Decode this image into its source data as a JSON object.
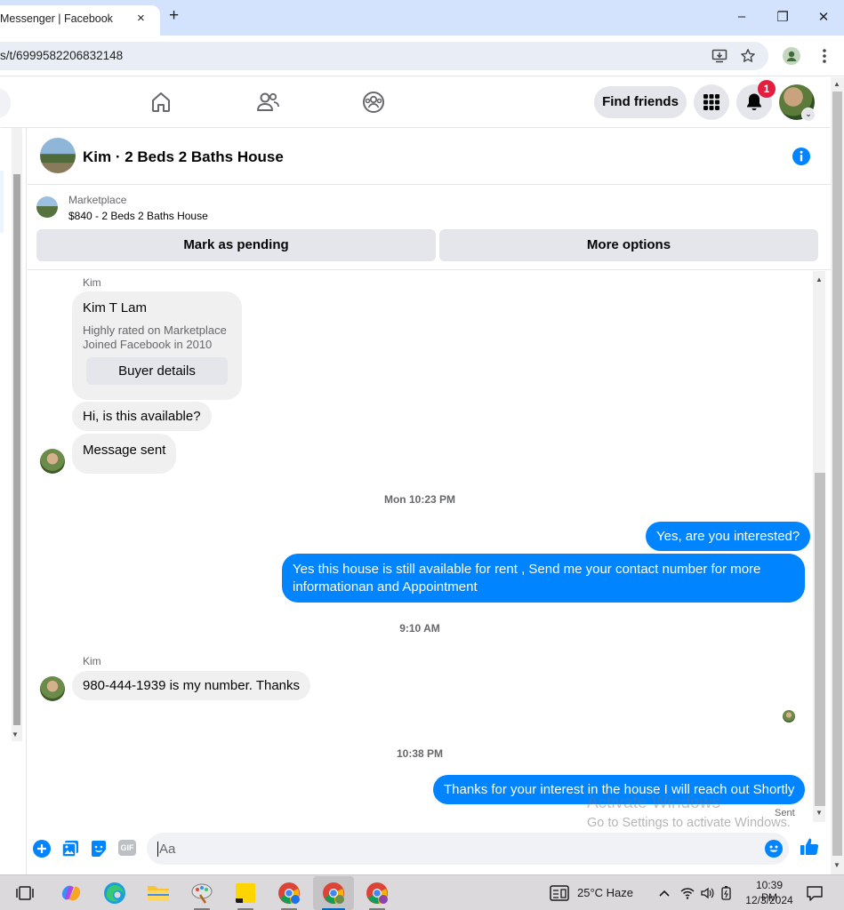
{
  "browser": {
    "tab_title": "Messenger | Facebook",
    "tab_close": "×",
    "new_tab": "+",
    "url": "s/t/6999582206832148",
    "window_controls": {
      "minimize": "–",
      "restore": "❐",
      "close": "✕"
    }
  },
  "fb_nav": {
    "find_friends": "Find friends",
    "notification_count": "1",
    "profile_caret": "⌄",
    "icons": [
      "home-icon",
      "friends-icon",
      "groups-icon",
      "menu-grid-icon",
      "bell-icon"
    ]
  },
  "conversation": {
    "title": "Kim · 2 Beds 2 Baths House"
  },
  "marketplace": {
    "label": "Marketplace",
    "listing": "$840 - 2 Beds 2 Baths House",
    "mark_pending": "Mark as pending",
    "more_options": "More options"
  },
  "messages": {
    "sender_kim_1": "Kim",
    "buyer_card": {
      "name": "Kim T Lam",
      "line1": "Highly rated on Marketplace",
      "line2": "Joined Facebook in 2010",
      "button": "Buyer details"
    },
    "kim_msg_1": "Hi, is this available?",
    "kim_msg_2": "Message sent",
    "time_1": "Mon 10:23 PM",
    "out_msg_1": "Yes, are you interested?",
    "out_msg_2": "Yes this house is still available for rent , Send me your contact number for more informationan and Appointment",
    "time_2": "9:10 AM",
    "sender_kim_2": "Kim",
    "kim_msg_3": "980-444-1939 is my number. Thanks",
    "time_3": "10:38 PM",
    "out_msg_3": "Thanks for your interest in the house I will reach out Shortly",
    "sent_status": "Sent"
  },
  "composer": {
    "placeholder": "Aa",
    "gif_label": "GIF"
  },
  "watermark": {
    "line1": "Activate Windows",
    "line2": "Go to Settings to activate Windows."
  },
  "taskbar": {
    "weather": "25°C  Haze",
    "time": "10:39 PM",
    "date": "12/3/2024"
  },
  "colors": {
    "messenger_blue": "#0084ff",
    "fb_blue": "#1877f2",
    "notification_red": "#e41e3f"
  }
}
